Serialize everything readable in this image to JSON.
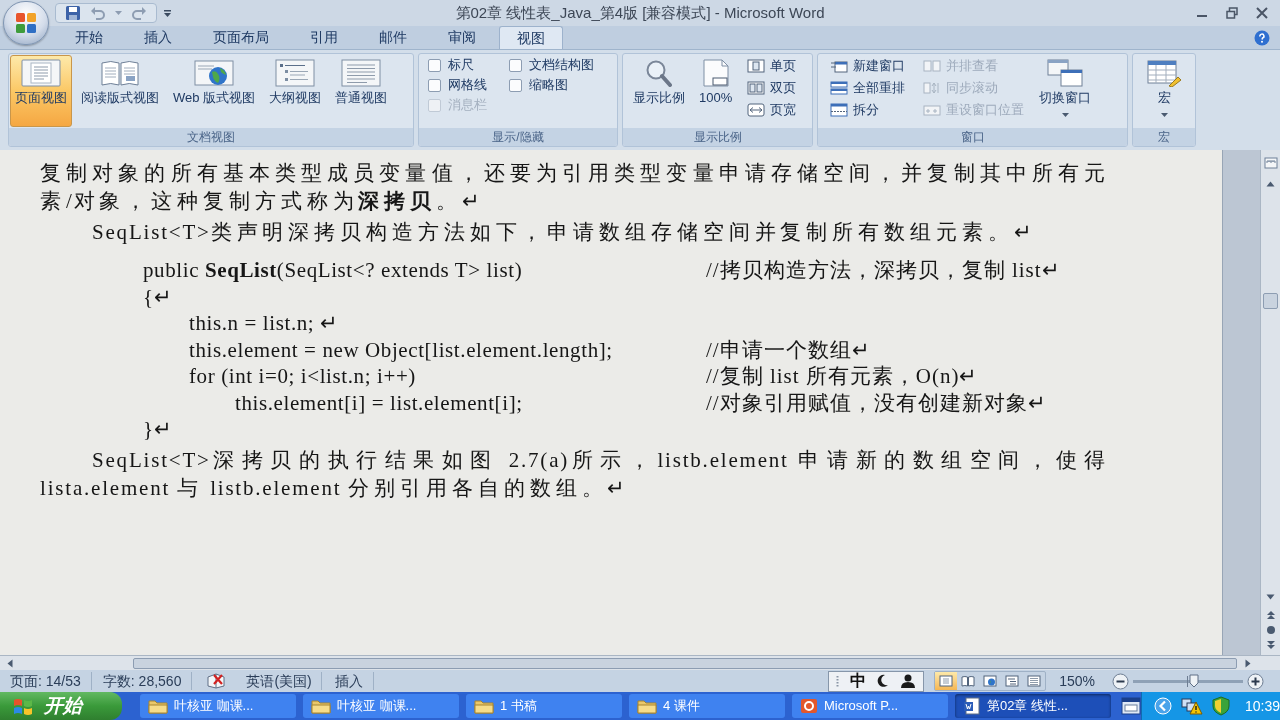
{
  "window": {
    "title": "第02章 线性表_Java_第4版 [兼容模式] - Microsoft Word"
  },
  "tabs": [
    {
      "label": "开始",
      "selected": false
    },
    {
      "label": "插入",
      "selected": false
    },
    {
      "label": "页面布局",
      "selected": false
    },
    {
      "label": "引用",
      "selected": false
    },
    {
      "label": "邮件",
      "selected": false
    },
    {
      "label": "审阅",
      "selected": false
    },
    {
      "label": "视图",
      "selected": true
    }
  ],
  "ribbon": [
    {
      "label": "文档视图",
      "items": [
        {
          "kind": "large",
          "label": "页面视图",
          "selected": true
        },
        {
          "kind": "large",
          "label": "阅读版式视图",
          "selected": false
        },
        {
          "kind": "large",
          "label": "Web 版式视图",
          "selected": false
        },
        {
          "kind": "large",
          "label": "大纲视图",
          "selected": false
        },
        {
          "kind": "large",
          "label": "普通视图",
          "selected": false
        }
      ]
    },
    {
      "label": "显示/隐藏",
      "items": [
        {
          "kind": "checkbox",
          "label": "标尺",
          "checked": false,
          "disabled": false
        },
        {
          "kind": "checkbox",
          "label": "网格线",
          "checked": false,
          "disabled": false
        },
        {
          "kind": "checkbox",
          "label": "消息栏",
          "checked": false,
          "disabled": true
        },
        {
          "kind": "checkbox",
          "label": "文档结构图",
          "checked": false,
          "disabled": false
        },
        {
          "kind": "checkbox",
          "label": "缩略图",
          "checked": false,
          "disabled": false
        }
      ]
    },
    {
      "label": "显示比例",
      "items": [
        {
          "kind": "large",
          "label": "显示比例"
        },
        {
          "kind": "large",
          "label": "100%"
        },
        {
          "kind": "small",
          "label": "单页"
        },
        {
          "kind": "small",
          "label": "双页"
        },
        {
          "kind": "small",
          "label": "页宽"
        }
      ]
    },
    {
      "label": "窗口",
      "items": [
        {
          "kind": "small",
          "label": "新建窗口",
          "disabled": false
        },
        {
          "kind": "small",
          "label": "全部重排",
          "disabled": false
        },
        {
          "kind": "small",
          "label": "拆分",
          "disabled": false
        },
        {
          "kind": "small",
          "label": "并排查看",
          "disabled": true
        },
        {
          "kind": "small",
          "label": "同步滚动",
          "disabled": true
        },
        {
          "kind": "small",
          "label": "重设窗口位置",
          "disabled": true
        },
        {
          "kind": "menu",
          "label": "切换窗口",
          "disabled": false
        }
      ]
    },
    {
      "label": "宏",
      "items": [
        {
          "kind": "menu",
          "label": "宏"
        }
      ]
    }
  ],
  "document": {
    "blocks": [
      {
        "kind": "text",
        "text": "复制对象的所有基本类型成员变量值，还要为引用类型变量申请存储空间，并复制其中所有元素/对象，这种复制方式称为**深拷贝**。↵"
      },
      {
        "kind": "indented",
        "text": "SeqList<T>类声明深拷贝构造方法如下，申请数组存储空间并复制所有数组元素。↵"
      },
      {
        "kind": "code",
        "lines": [
          {
            "code": "public **SeqList**(SeqList<? extends T> list)",
            "comment": "//拷贝构造方法，深拷贝，复制 list↵"
          },
          {
            "code": "{↵",
            "children": [
              {
                "code": "this.n = list.n; ↵"
              },
              {
                "code": "this.element = new Object[list.element.length];",
                "comment": "//申请一个数组↵"
              },
              {
                "code": "for (int i=0; i<list.n; i++)",
                "comment": "//复制 list 所有元素，O(n)↵",
                "children": [
                  {
                    "code": "this.element[i] = list.element[i];",
                    "comment": "//对象引用赋值，没有创建新对象↵"
                  }
                ]
              }
            ]
          },
          {
            "code": "}↵"
          }
        ]
      },
      {
        "kind": "indented",
        "text": "SeqList<T>深拷贝的执行结果如图 2.7(a)所示，listb.element 申请新的数组空间，使得lista.element 与 listb.element 分别引用各自的数组。↵"
      }
    ]
  },
  "status_bar": {
    "page": "页面: 14/53",
    "word_count": "字数: 28,560",
    "language": "英语(美国)",
    "mode": "插入",
    "ime": {
      "mode": "中"
    },
    "view_buttons": [
      {
        "selected": true
      },
      {
        "selected": false
      },
      {
        "selected": false
      },
      {
        "selected": false
      },
      {
        "selected": false
      }
    ],
    "zoom": "150%",
    "zoom_slider": {
      "level": 0.55
    }
  },
  "taskbar": {
    "start": "开始",
    "tasks": [
      {
        "kind": "folder",
        "label": "叶核亚 咖课...",
        "selected": false
      },
      {
        "kind": "folder",
        "label": "叶核亚 咖课...",
        "selected": false
      },
      {
        "kind": "folder",
        "label": "1 书稿",
        "selected": false
      },
      {
        "kind": "folder",
        "label": "4 课件",
        "selected": false
      },
      {
        "kind": "presentation",
        "label": "Microsoft P...",
        "selected": false
      },
      {
        "kind": "document",
        "label": "第02章 线性...",
        "selected": true
      }
    ],
    "clock": "10:39"
  }
}
